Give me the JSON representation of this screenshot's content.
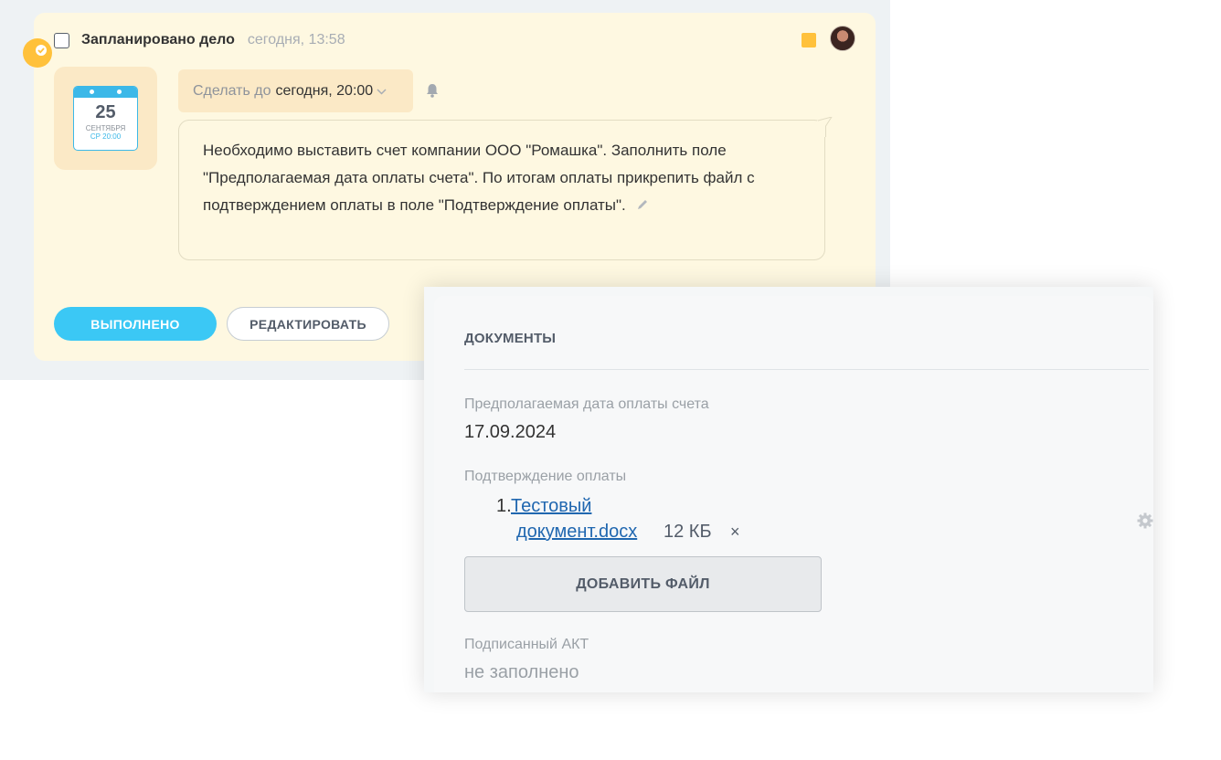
{
  "activity": {
    "title": "Запланировано дело",
    "time": "сегодня, 13:58",
    "calendar": {
      "day": "25",
      "month": "СЕНТЯБРЯ",
      "time": "СР 20:00"
    },
    "deadline": {
      "prefix": "Сделать до",
      "value": "сегодня, 20:00"
    },
    "description": "Необходимо выставить счет компании ООО \"Ромашка\". Заполнить поле \"Предполагаемая дата оплаты счета\". По итогам оплаты прикрепить файл с подтверждением оплаты в поле \"Подтверждение оплаты\".",
    "buttons": {
      "done": "ВЫПОЛНЕНО",
      "edit": "РЕДАКТИРОВАТЬ"
    },
    "colors": {
      "card_bg": "#fef8e1",
      "accent": "#ffc13b",
      "done_button": "#3bc8f5"
    }
  },
  "documents": {
    "title": "ДОКУМЕНТЫ",
    "fields": {
      "due_date": {
        "label": "Предполагаемая дата оплаты счета",
        "value": "17.09.2024"
      },
      "payment_confirmation": {
        "label": "Подтверждение оплаты",
        "files": [
          {
            "index": "1.",
            "name_line1": "Тестовый",
            "name_line2": "документ.docx",
            "size": "12 КБ",
            "remove": "×"
          }
        ],
        "add_button": "ДОБАВИТЬ ФАЙЛ"
      },
      "signed_act": {
        "label": "Подписанный АКТ",
        "value": "не заполнено"
      }
    },
    "colors": {
      "link": "#2067b0"
    }
  }
}
